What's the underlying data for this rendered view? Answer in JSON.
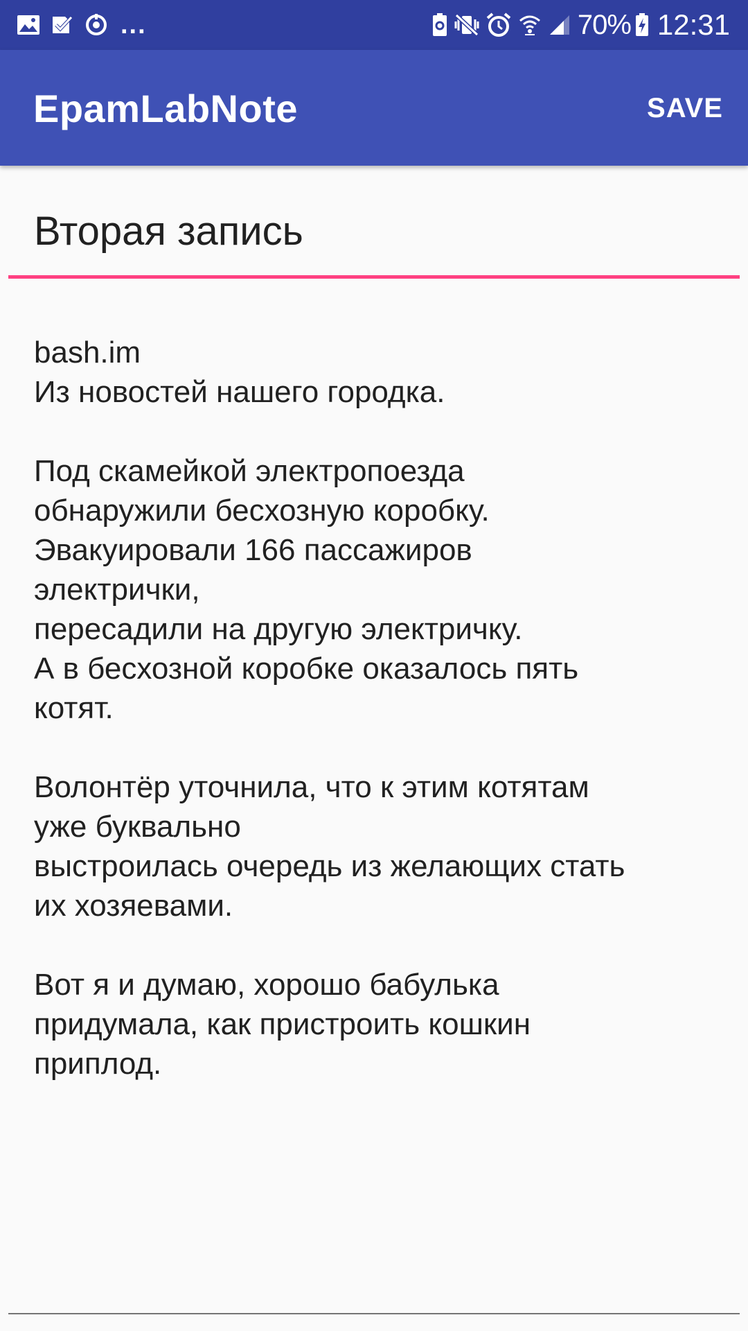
{
  "status_bar": {
    "battery_percent": "70%",
    "time": "12:31",
    "more_notifications": "...",
    "left_icons": [
      "image-icon",
      "task-check-icon",
      "sync-icon"
    ],
    "right_icons": [
      "battery-saver-icon",
      "vibrate-mute-icon",
      "alarm-icon",
      "wifi-icon",
      "signal-icon",
      "battery-charging-icon"
    ]
  },
  "app_bar": {
    "title": "EpamLabNote",
    "save_label": "SAVE",
    "color": "#3f51b5",
    "status_color": "#303f9f"
  },
  "note": {
    "title": "Вторая запись",
    "accent_color": "#ff4081",
    "body": "bash.im\nИз новостей нашего городка.\n\nПод скамейкой электропоезда\nобнаружили бесхозную коробку.\nЭвакуировали 166 пассажиров\nэлектрички,\nпересадили на другую электричку.\nА в бесхозной коробке оказалось пять\nкотят.\n\nВолонтёр уточнила, что к этим котятам\nуже буквально\nвыстроилась очередь из желающих стать\nих хозяевами.\n\nВот я и думаю, хорошо бабулька\nпридумала, как пристроить кошкин\nприплод."
  }
}
